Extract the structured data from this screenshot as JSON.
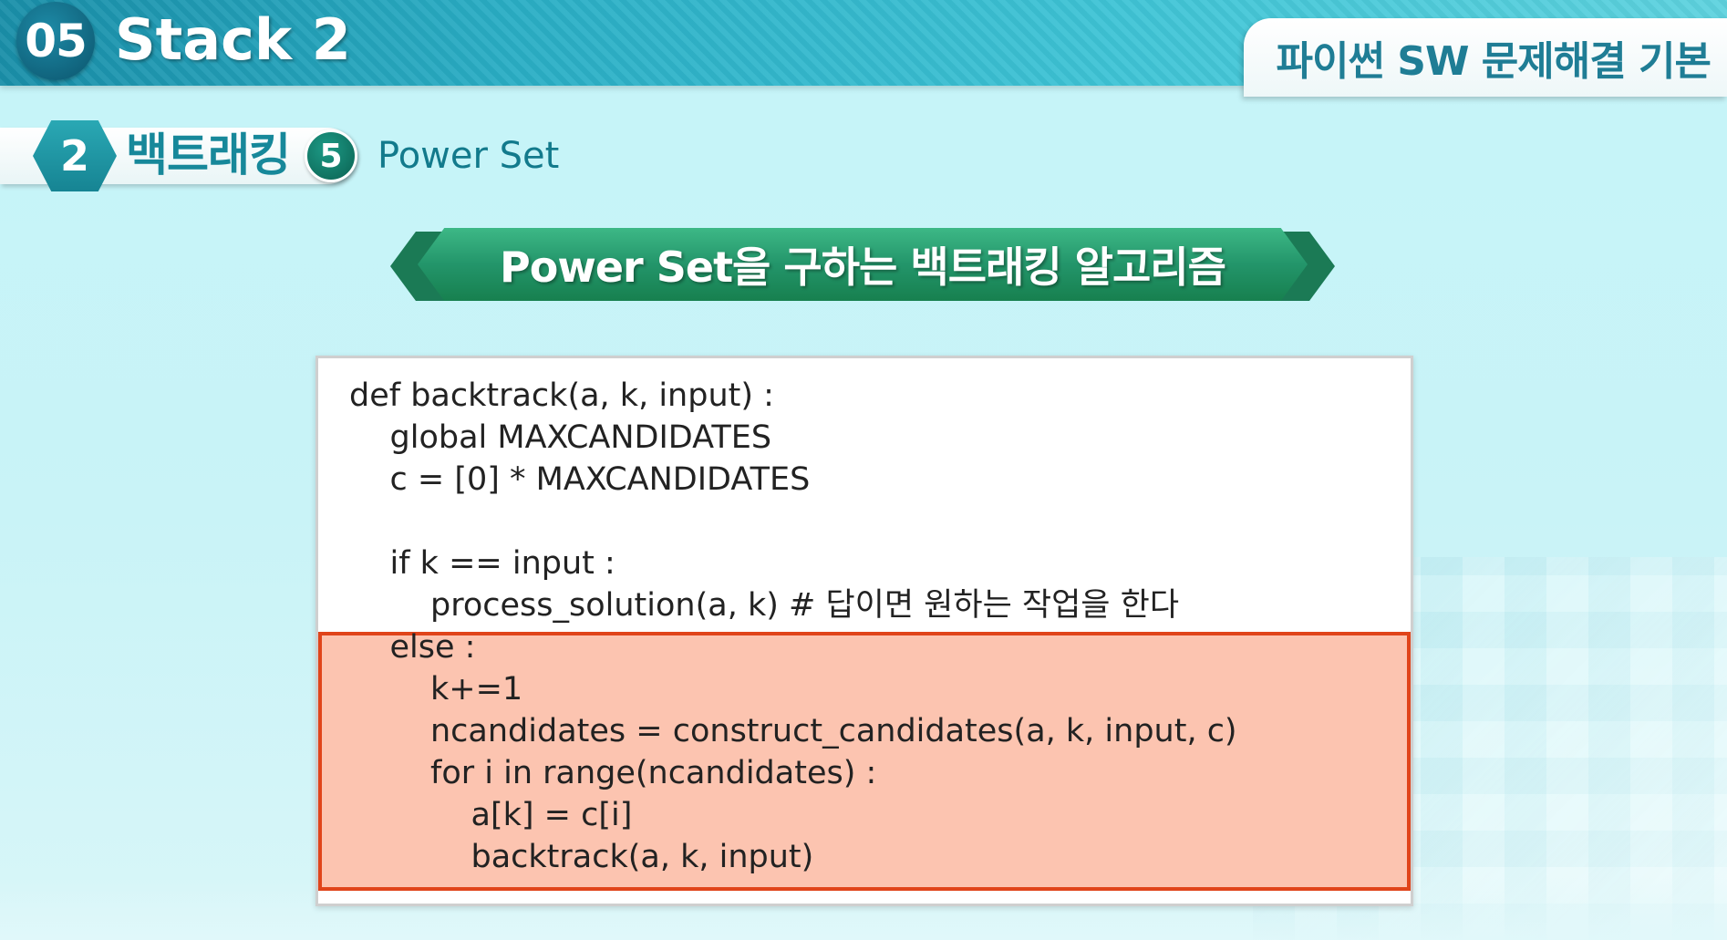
{
  "header": {
    "chapter_number": "05",
    "chapter_title": "Stack 2",
    "course_title": "파이썬 SW 문제해결 기본"
  },
  "breadcrumb": {
    "section_number": "2",
    "section_title": "백트래킹",
    "topic_number": "5",
    "topic_title": "Power Set"
  },
  "banner": {
    "title": "Power Set을 구하는 백트래킹 알고리즘"
  },
  "code": {
    "lines": [
      "def backtrack(a, k, input) :",
      "    global MAXCANDIDATES",
      "    c = [0] * MAXCANDIDATES",
      "",
      "    if k == input :",
      "        process_solution(a, k) # 답이면 원하는 작업을 한다",
      "    else :",
      "        k+=1",
      "        ncandidates = construct_candidates(a, k, input, c)",
      "        for i in range(ncandidates) :",
      "            a[k] = c[i]",
      "            backtrack(a, k, input)"
    ],
    "highlighted_range": "else block (lines 7-12)"
  },
  "colors": {
    "header_bar": "#2aaec5",
    "banner_green": "#23956a",
    "highlight_fill": "#fcc4b0",
    "highlight_border": "#e0441a",
    "accent_teal": "#17889a"
  }
}
